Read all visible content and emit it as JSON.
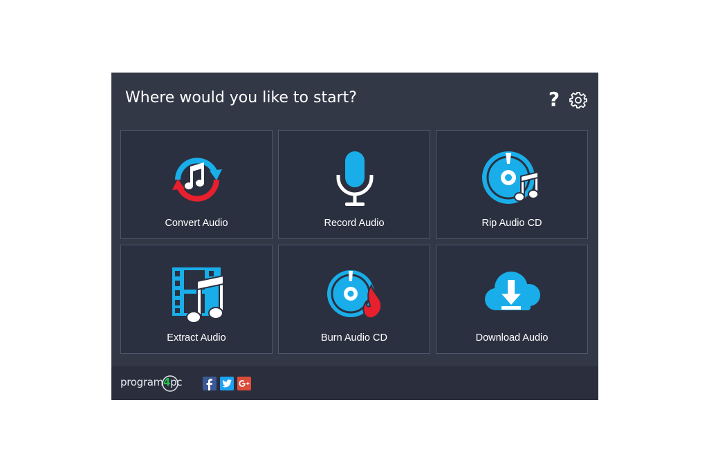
{
  "header": {
    "title": "Where would you like to start?",
    "help_icon": "question-mark-icon",
    "settings_icon": "gear-icon"
  },
  "tiles": [
    {
      "label": "Convert Audio",
      "icon": "convert-audio-icon"
    },
    {
      "label": "Record Audio",
      "icon": "microphone-icon"
    },
    {
      "label": "Rip Audio CD",
      "icon": "rip-cd-icon"
    },
    {
      "label": "Extract Audio",
      "icon": "film-music-icon"
    },
    {
      "label": "Burn Audio CD",
      "icon": "burn-cd-icon"
    },
    {
      "label": "Download Audio",
      "icon": "cloud-download-icon"
    }
  ],
  "footer": {
    "logo_text_main": "program",
    "logo_text_num": "4",
    "logo_text_end": "pc",
    "social": [
      {
        "name": "facebook",
        "color": "#3b5998",
        "glyph": "f"
      },
      {
        "name": "twitter",
        "color": "#1da1f2",
        "glyph": "t"
      },
      {
        "name": "google-plus",
        "color": "#dd4b39",
        "glyph": "G+"
      }
    ]
  },
  "colors": {
    "window_bg": "#333847",
    "tile_bg": "#2b3040",
    "tile_border": "#50576a",
    "accent_blue": "#19aee9",
    "accent_red": "#e8202e",
    "footer_bg": "#2b2f3d"
  }
}
